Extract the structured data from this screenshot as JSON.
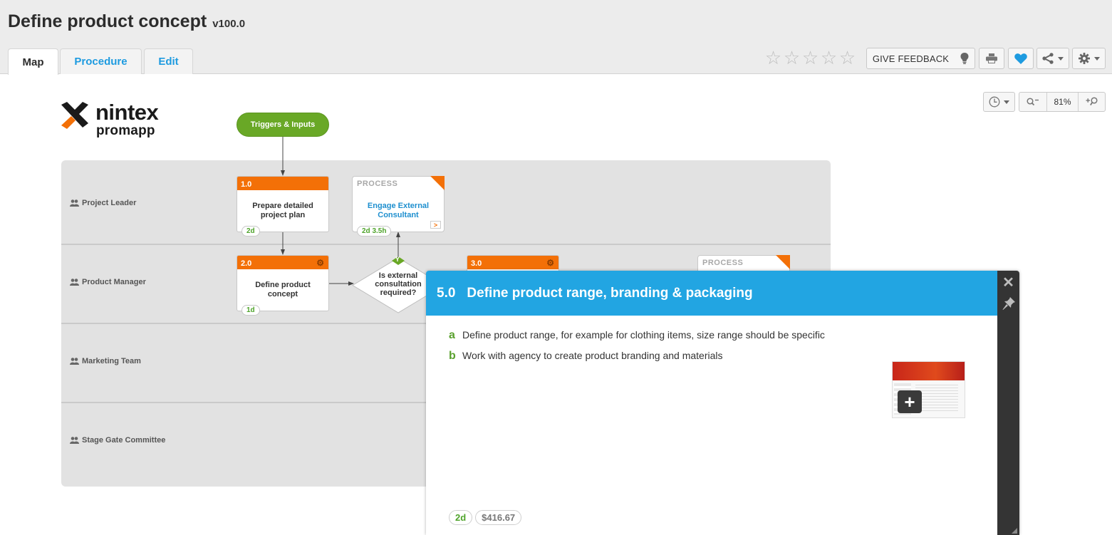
{
  "header": {
    "title": "Define product concept",
    "version": "v100.0",
    "tabs": [
      {
        "label": "Map",
        "active": true
      },
      {
        "label": "Procedure",
        "active": false
      },
      {
        "label": "Edit",
        "active": false
      }
    ],
    "rating": {
      "value": 0,
      "max": 5,
      "icon": "star-outline-icon"
    },
    "feedback_label": "GIVE FEEDBACK",
    "toolbar_icons": [
      "lightbulb-icon",
      "print-icon",
      "heart-icon",
      "share-icon",
      "gear-icon"
    ],
    "accent_color": "#1e9be0",
    "heart_color": "#1e9be0"
  },
  "map_controls": {
    "history_icon": "history-clock-icon",
    "zoom_out_icon": "zoom-out-icon",
    "zoom_level": "81%",
    "zoom_in_icon": "zoom-in-icon"
  },
  "logo": {
    "line1": "nintex",
    "line2": "promapp",
    "trademark": "™"
  },
  "trigger": {
    "label": "Triggers & Inputs",
    "color": "#69a826"
  },
  "lanes": [
    {
      "label": "Project Leader",
      "icon": "users-icon"
    },
    {
      "label": "Product Manager",
      "icon": "users-icon"
    },
    {
      "label": "Marketing Team",
      "icon": "users-icon"
    },
    {
      "label": "Stage Gate Committee",
      "icon": "users-icon"
    }
  ],
  "activities": [
    {
      "number": "1.0",
      "name": "Prepare detailed project plan",
      "duration": "2d",
      "has_gear": false
    },
    {
      "number": "2.0",
      "name": "Define product concept",
      "duration": "1d",
      "has_gear": true
    },
    {
      "number": "3.0",
      "name": "",
      "duration": "",
      "has_gear": true
    }
  ],
  "processes": [
    {
      "tag": "PROCESS",
      "name": "Engage External Consultant",
      "duration": "2d 3.5h",
      "link_icon": "process-link-icon"
    },
    {
      "tag": "PROCESS",
      "name": "",
      "duration": ""
    }
  ],
  "decision": {
    "text": "Is external consultation required?",
    "yes_label": "Y"
  },
  "activity_color": "#f37007",
  "popup": {
    "number": "5.0",
    "title": "Define product range, branding & packaging",
    "header_color": "#22a5e2",
    "steps": [
      {
        "letter": "a",
        "text": "Define product range, for example for clothing items, size range should be specific"
      },
      {
        "letter": "b",
        "text": "Work with agency to create product branding and materials"
      }
    ],
    "attachment": {
      "kind": "screenshot-thumbnail",
      "action_icon": "plus-icon"
    },
    "duration": "2d",
    "cost": "$416.67",
    "side_icons": [
      "close-icon",
      "pin-icon"
    ]
  }
}
